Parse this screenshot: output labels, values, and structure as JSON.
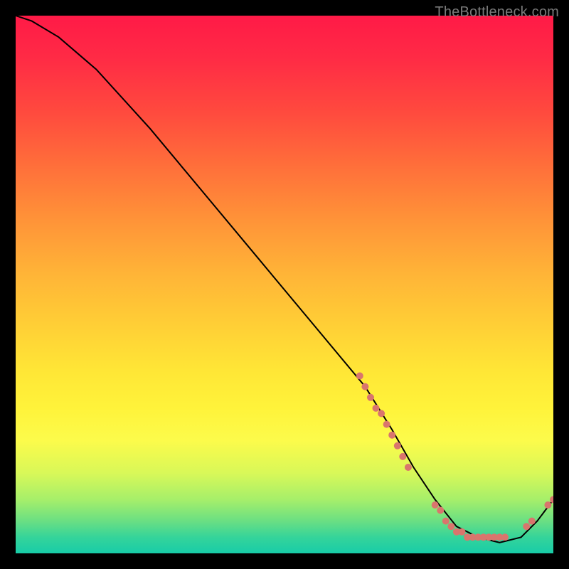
{
  "watermark": "TheBottleneck.com",
  "colors": {
    "background": "#000000",
    "gradient_top": "#ff1a47",
    "gradient_mid": "#ffd036",
    "gradient_bottom": "#18cca8",
    "curve": "#000000",
    "points": "#d9756d"
  },
  "chart_data": {
    "type": "line",
    "title": "",
    "xlabel": "",
    "ylabel": "",
    "xlim": [
      0,
      100
    ],
    "ylim": [
      0,
      100
    ],
    "grid": false,
    "legend": false,
    "annotations": [],
    "curve": {
      "description": "Bottleneck percentage curve: steep descent from top-left to a flat minimum near x≈80–90, slight rise at far right",
      "x": [
        0,
        3,
        8,
        15,
        25,
        35,
        45,
        55,
        65,
        70,
        74,
        78,
        82,
        86,
        90,
        94,
        97,
        100
      ],
      "y": [
        100,
        99,
        96,
        90,
        79,
        67,
        55,
        43,
        31,
        23,
        16,
        10,
        5,
        3,
        2,
        3,
        6,
        10
      ]
    },
    "scatter_on_curve": {
      "description": "Highlighted sample points lying on or near the curve, clustered along the descent near the bottom and along the trough",
      "points": [
        {
          "x": 64,
          "y": 33
        },
        {
          "x": 65,
          "y": 31
        },
        {
          "x": 66,
          "y": 29
        },
        {
          "x": 67,
          "y": 27
        },
        {
          "x": 68,
          "y": 26
        },
        {
          "x": 69,
          "y": 24
        },
        {
          "x": 70,
          "y": 22
        },
        {
          "x": 71,
          "y": 20
        },
        {
          "x": 72,
          "y": 18
        },
        {
          "x": 73,
          "y": 16
        },
        {
          "x": 78,
          "y": 9
        },
        {
          "x": 79,
          "y": 8
        },
        {
          "x": 80,
          "y": 6
        },
        {
          "x": 81,
          "y": 5
        },
        {
          "x": 82,
          "y": 4
        },
        {
          "x": 83,
          "y": 4
        },
        {
          "x": 84,
          "y": 3
        },
        {
          "x": 85,
          "y": 3
        },
        {
          "x": 86,
          "y": 3
        },
        {
          "x": 87,
          "y": 3
        },
        {
          "x": 88,
          "y": 3
        },
        {
          "x": 89,
          "y": 3
        },
        {
          "x": 90,
          "y": 3
        },
        {
          "x": 91,
          "y": 3
        },
        {
          "x": 95,
          "y": 5
        },
        {
          "x": 96,
          "y": 6
        },
        {
          "x": 99,
          "y": 9
        },
        {
          "x": 100,
          "y": 10
        }
      ]
    }
  }
}
